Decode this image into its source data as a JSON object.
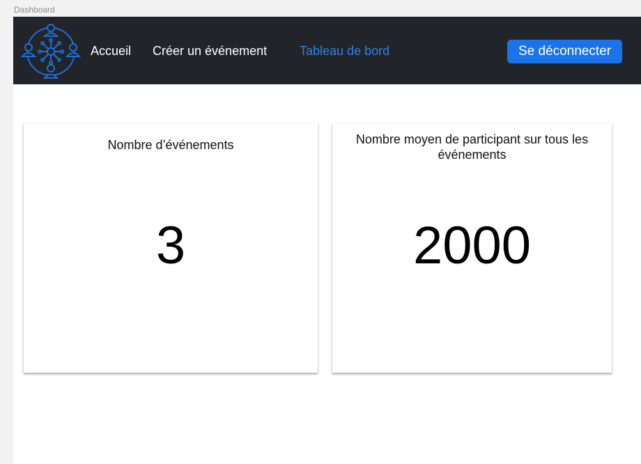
{
  "frame": {
    "label": "Dashboard"
  },
  "navbar": {
    "logo_icon": "people-network-icon",
    "links": [
      {
        "label": "Accueil",
        "active": false
      },
      {
        "label": "Créer un événement",
        "active": false
      },
      {
        "label": "Tableau de bord",
        "active": true
      }
    ],
    "logout_label": "Se déconnecter",
    "colors": {
      "background": "#212529",
      "link": "#ffffff",
      "active_link": "#2f80ed",
      "button": "#1a73e8",
      "logo": "#1f6fd6"
    }
  },
  "cards": [
    {
      "title": "Nombre d’événements",
      "value": "3"
    },
    {
      "title": "Nombre moyen de participant sur tous les événements",
      "value": "2000"
    }
  ]
}
